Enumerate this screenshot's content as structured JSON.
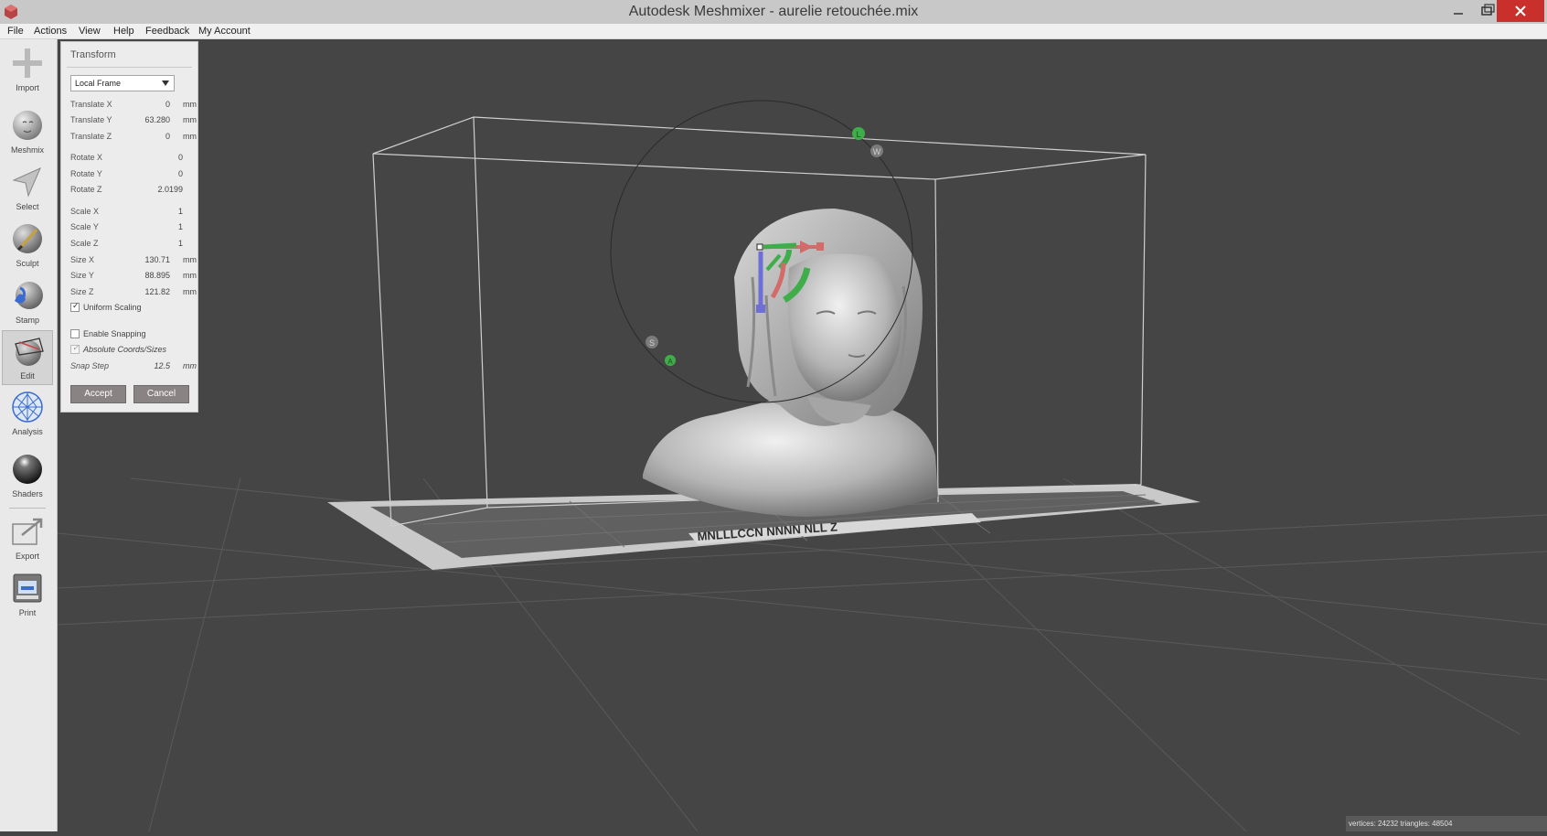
{
  "window": {
    "title": "Autodesk Meshmixer - aurelie retouchée.mix",
    "minimize_glyph": "—",
    "maximize_glyph": "❐",
    "close_glyph": "✕"
  },
  "menu": [
    "File",
    "Actions",
    "View",
    "Help",
    "Feedback",
    "My Account"
  ],
  "toolbar": [
    {
      "label": "Import",
      "icon": "plus-icon"
    },
    {
      "label": "Meshmix",
      "icon": "head-sphere-icon"
    },
    {
      "label": "Select",
      "icon": "arrow-cursor-icon"
    },
    {
      "label": "Sculpt",
      "icon": "brush-icon"
    },
    {
      "label": "Stamp",
      "icon": "stamp-icon"
    },
    {
      "label": "Edit",
      "icon": "edit-mesh-icon",
      "active": true
    },
    {
      "label": "Analysis",
      "icon": "analysis-sphere-icon"
    },
    {
      "label": "Shaders",
      "icon": "shader-sphere-icon"
    },
    {
      "label": "Export",
      "icon": "export-icon"
    },
    {
      "label": "Print",
      "icon": "printer-icon"
    }
  ],
  "transform": {
    "title": "Transform",
    "frame": "Local Frame",
    "translate_x": {
      "label": "Translate X",
      "value": "0",
      "unit": "mm"
    },
    "translate_y": {
      "label": "Translate Y",
      "value": "63.280",
      "unit": "mm"
    },
    "translate_z": {
      "label": "Translate Z",
      "value": "0",
      "unit": "mm"
    },
    "rotate_x": {
      "label": "Rotate X",
      "value": "0"
    },
    "rotate_y": {
      "label": "Rotate Y",
      "value": "0"
    },
    "rotate_z": {
      "label": "Rotate Z",
      "value": "2.0199"
    },
    "scale_x": {
      "label": "Scale X",
      "value": "1"
    },
    "scale_y": {
      "label": "Scale Y",
      "value": "1"
    },
    "scale_z": {
      "label": "Scale Z",
      "value": "1"
    },
    "size_x": {
      "label": "Size X",
      "value": "130.71",
      "unit": "mm"
    },
    "size_y": {
      "label": "Size Y",
      "value": "88.895",
      "unit": "mm"
    },
    "size_z": {
      "label": "Size Z",
      "value": "121.82",
      "unit": "mm"
    },
    "uniform_scaling": {
      "label": "Uniform Scaling",
      "checked": true
    },
    "enable_snapping": {
      "label": "Enable Snapping",
      "checked": false
    },
    "absolute_coords": {
      "label": "Absolute Coords/Sizes",
      "checked": true
    },
    "snap_step": {
      "label": "Snap Step",
      "value": "12.5",
      "unit": "mm"
    },
    "accept": "Accept",
    "cancel": "Cancel"
  },
  "gizmo": {
    "handle_l": "L",
    "handle_w": "W",
    "handle_s": "S",
    "handle_a": "A"
  },
  "status": "vertices: 24232 triangles: 48504",
  "colors": {
    "viewport_bg": "#454545",
    "gizmo_green": "#3fae4a",
    "gizmo_red": "#d46a6a",
    "gizmo_blue": "#6d6fd6",
    "close_red": "#c9302c"
  }
}
